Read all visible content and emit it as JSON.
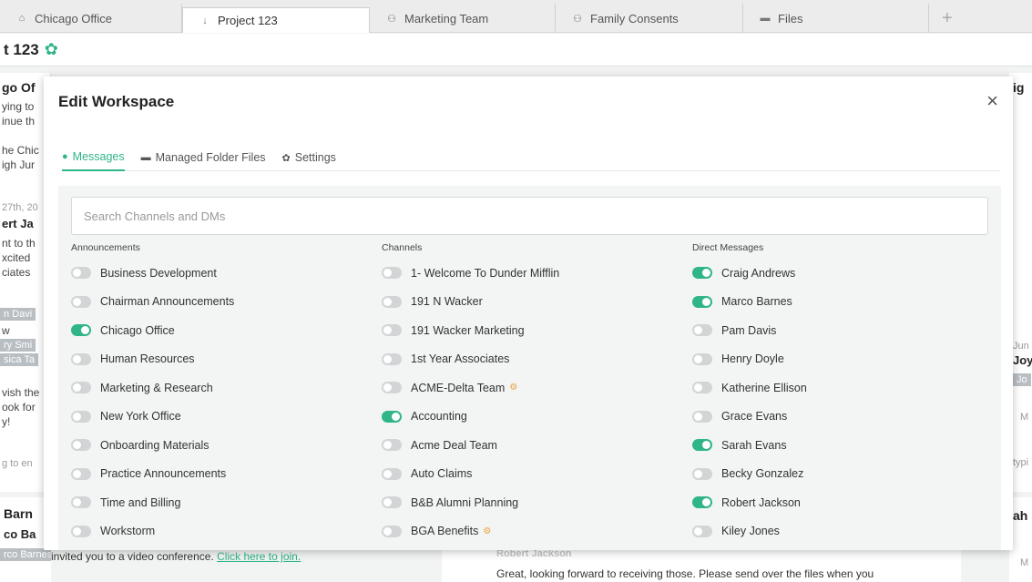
{
  "tabs": [
    {
      "label": "Chicago Office",
      "icon": "building-icon",
      "glyph": "⌂"
    },
    {
      "label": "Project 123",
      "icon": "pin-icon",
      "glyph": "↓"
    },
    {
      "label": "Marketing Team",
      "icon": "people-icon",
      "glyph": "⚇"
    },
    {
      "label": "Family Consents",
      "icon": "people-icon",
      "glyph": "⚇"
    },
    {
      "label": "Files",
      "icon": "folder-icon",
      "glyph": "▬"
    },
    {
      "label": "+",
      "icon": "plus-icon",
      "glyph": ""
    }
  ],
  "workspace": {
    "title": "t 123",
    "gear": "✿"
  },
  "background": {
    "left": [
      "go Of",
      "ying to",
      "inue th",
      "he Chic",
      "igh Jur",
      "27th, 20",
      "ert Ja",
      "nt to th",
      "xcited",
      "ciates",
      "n Davi",
      "w",
      "ry Smi",
      "sica Ta",
      "vish the",
      "ook for",
      "y!",
      "g to en"
    ],
    "left_bottom": [
      "Barn",
      "co Ba",
      "rco Barnes"
    ],
    "right": [
      "ig",
      "Jun",
      "Joy",
      "Jo",
      "M",
      "typi"
    ],
    "right_bottom": [
      "ah",
      "M"
    ],
    "invite_text": "invited you to a video conference.",
    "invite_link": "Click here to join.",
    "mid_sender": "Robert Jackson",
    "mid_text": "Great, looking forward to receiving those. Please send over the files when you"
  },
  "modal": {
    "title": "Edit Workspace",
    "close": "×",
    "tabs": [
      {
        "label": "Messages",
        "glyph": "●"
      },
      {
        "label": "Managed Folder Files",
        "glyph": "▬"
      },
      {
        "label": "Settings",
        "glyph": "✿"
      }
    ],
    "search_placeholder": "Search Channels and DMs",
    "columns": [
      {
        "header": "Announcements",
        "items": [
          {
            "label": "Business Development",
            "on": false
          },
          {
            "label": "Chairman Announcements",
            "on": false
          },
          {
            "label": "Chicago Office",
            "on": true
          },
          {
            "label": "Human Resources",
            "on": false
          },
          {
            "label": "Marketing & Research",
            "on": false
          },
          {
            "label": "New York Office",
            "on": false
          },
          {
            "label": "Onboarding Materials",
            "on": false
          },
          {
            "label": "Practice Announcements",
            "on": false
          },
          {
            "label": "Time and Billing",
            "on": false
          },
          {
            "label": "Workstorm",
            "on": false
          }
        ]
      },
      {
        "header": "Channels",
        "items": [
          {
            "label": "1- Welcome To Dunder Mifflin",
            "on": false
          },
          {
            "label": "191 N Wacker",
            "on": false
          },
          {
            "label": "191 Wacker Marketing",
            "on": false
          },
          {
            "label": "1st Year Associates",
            "on": false
          },
          {
            "label": "ACME-Delta Team",
            "on": false,
            "badge": "⚙"
          },
          {
            "label": "Accounting",
            "on": true
          },
          {
            "label": "Acme Deal Team",
            "on": false
          },
          {
            "label": "Auto Claims",
            "on": false
          },
          {
            "label": "B&B Alumni Planning",
            "on": false
          },
          {
            "label": "BGA Benefits",
            "on": false,
            "badge": "⚙"
          }
        ]
      },
      {
        "header": "Direct Messages",
        "items": [
          {
            "label": "Craig Andrews",
            "on": true
          },
          {
            "label": "Marco Barnes",
            "on": true
          },
          {
            "label": "Pam Davis",
            "on": false
          },
          {
            "label": "Henry Doyle",
            "on": false
          },
          {
            "label": "Katherine Ellison",
            "on": false
          },
          {
            "label": "Grace Evans",
            "on": false
          },
          {
            "label": "Sarah Evans",
            "on": true
          },
          {
            "label": "Becky Gonzalez",
            "on": false
          },
          {
            "label": "Robert Jackson",
            "on": true
          },
          {
            "label": "Kiley Jones",
            "on": false
          }
        ]
      }
    ]
  },
  "colors": {
    "accent": "#2fb588",
    "toggle_off": "#d2d4d6",
    "badge": "#e8a63a"
  }
}
